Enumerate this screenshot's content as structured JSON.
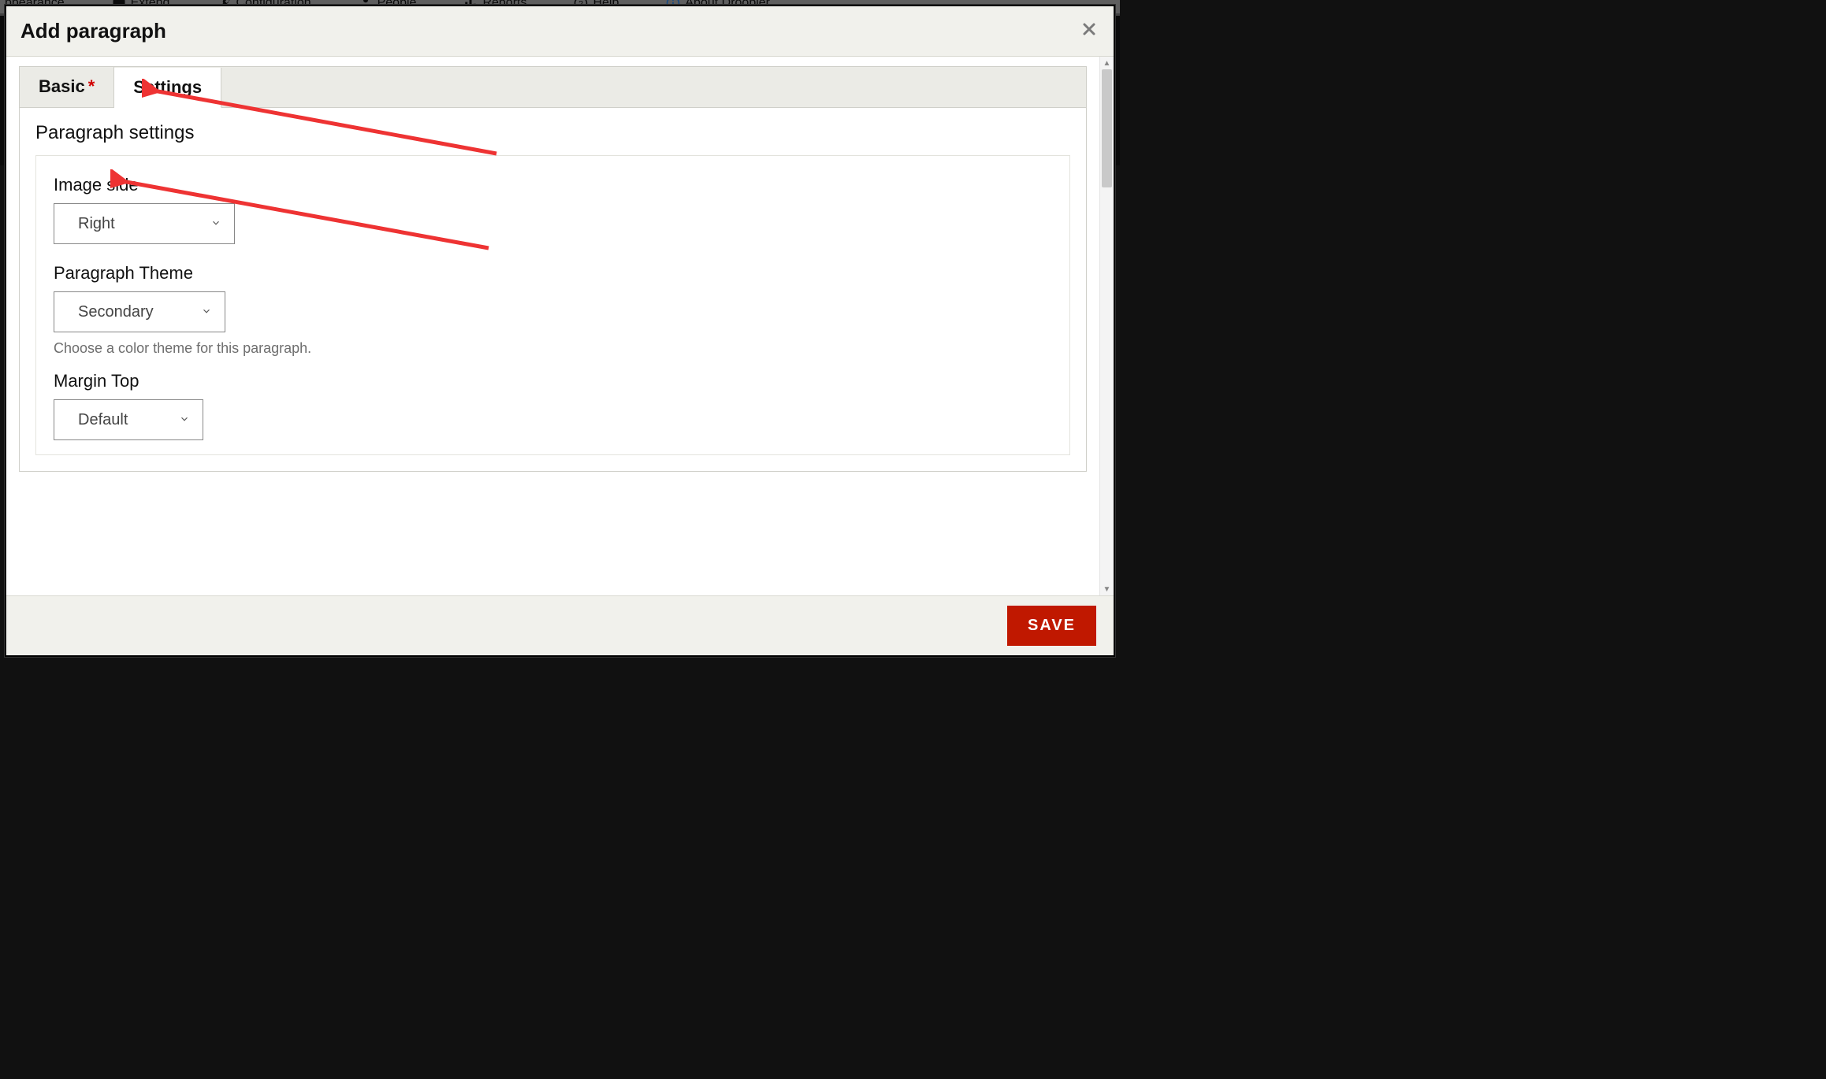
{
  "admin_menu": {
    "items": [
      {
        "label": "ppearance"
      },
      {
        "label": "Extend"
      },
      {
        "label": "Configuration"
      },
      {
        "label": "People"
      },
      {
        "label": "Reports"
      },
      {
        "label": "Help"
      },
      {
        "label": "About Droopler"
      }
    ]
  },
  "modal": {
    "title": "Add paragraph",
    "close_icon": "×",
    "tabs": [
      {
        "id": "basic",
        "label": "Basic",
        "required": true,
        "active": false
      },
      {
        "id": "settings",
        "label": "Settings",
        "required": false,
        "active": true
      }
    ],
    "settings_panel": {
      "heading": "Paragraph settings",
      "fields": {
        "image_side": {
          "label": "Image side",
          "value": "Right"
        },
        "paragraph_theme": {
          "label": "Paragraph Theme",
          "value": "Secondary",
          "help": "Choose a color theme for this paragraph."
        },
        "margin_top": {
          "label": "Margin Top",
          "value": "Default"
        }
      }
    },
    "footer": {
      "save_label": "SAVE"
    }
  }
}
